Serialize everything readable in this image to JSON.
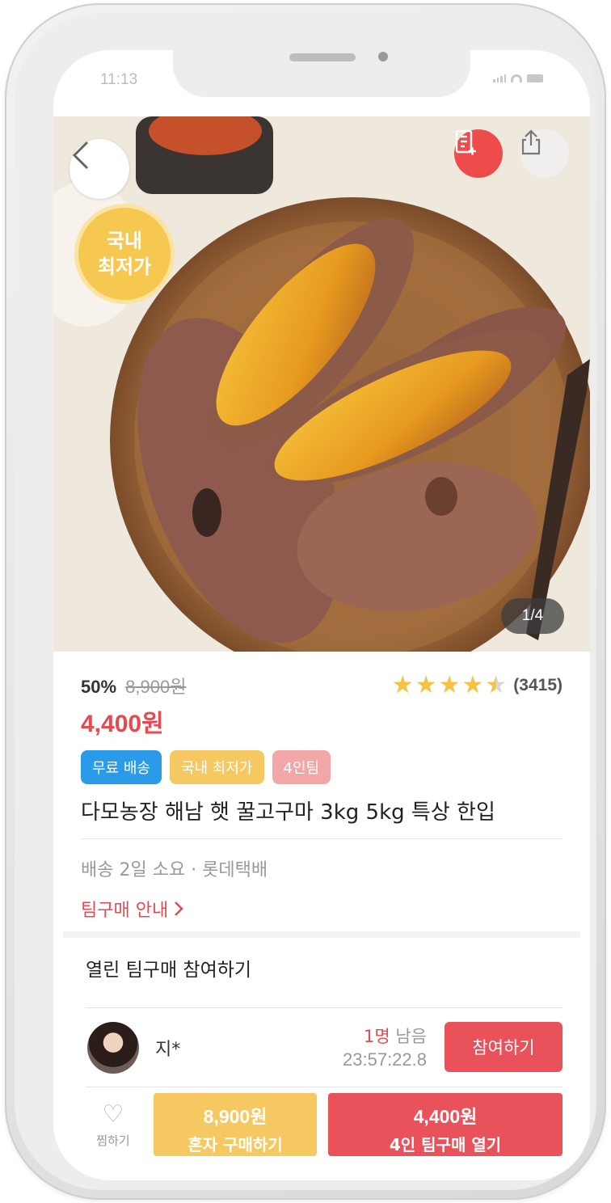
{
  "status_bar": {
    "time": "11:13"
  },
  "hero": {
    "badge_line1": "국내",
    "badge_line2": "최저가",
    "page_counter": "1/4"
  },
  "product": {
    "discount": "50%",
    "original_price": "8,900원",
    "sale_price": "4,400원",
    "rating_stars": 4.5,
    "review_count": "(3415)",
    "tags": [
      "무료 배송",
      "국내 최저가",
      "4인팀"
    ],
    "title": "다모농장 해남 햇 꿀고구마 3kg 5kg 특상 한입",
    "shipping": "배송 2일 소요 · 롯데택배",
    "guide_link": "팀구매 안내"
  },
  "team_section": {
    "header": "열린 팀구매 참여하기",
    "row": {
      "user": "지*",
      "remain_count": "1명",
      "remain_suffix": " 남음",
      "timer": "23:57:22.8",
      "join_label": "참여하기"
    }
  },
  "bottom_bar": {
    "wish_label": "찜하기",
    "solo_price": "8,900원",
    "solo_label": "혼자 구매하기",
    "team_price": "4,400원",
    "team_label": "4인 팀구매 열기"
  },
  "colors": {
    "accent_red": "#e9525a",
    "accent_yellow": "#f6c862",
    "accent_blue": "#2a9be8",
    "tag_pink": "#f3a6a6"
  },
  "icons": [
    "back-chevron-icon",
    "list-add-icon",
    "share-icon",
    "star-icon",
    "chevron-right-icon",
    "heart-icon"
  ]
}
